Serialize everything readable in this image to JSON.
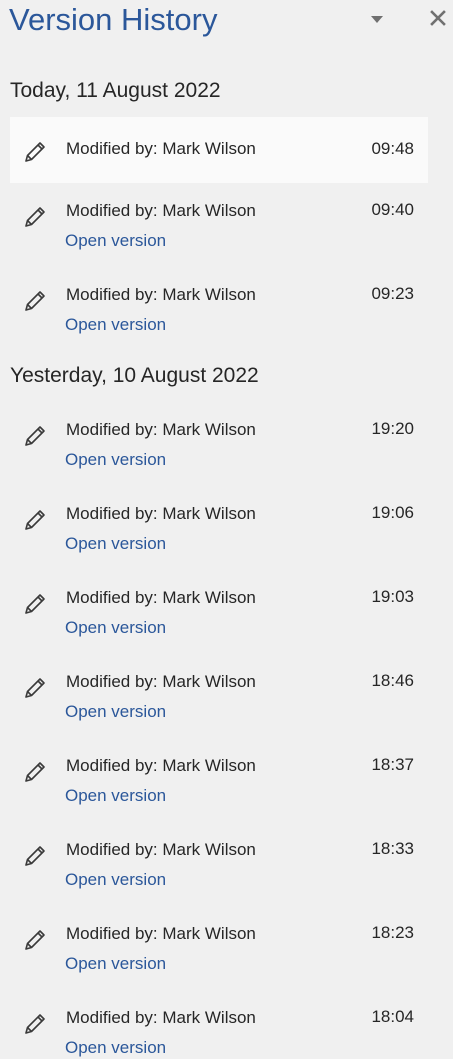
{
  "pane": {
    "title": "Version History",
    "options_icon": "triangle-down-icon",
    "close_icon": "close-icon"
  },
  "colors": {
    "accent": "#2b579a",
    "background": "#f0f0f0",
    "selected_background": "#fafafa",
    "text": "#262626"
  },
  "sections": [
    {
      "heading": "Today, 11 August 2022",
      "items": [
        {
          "modified_by": "Modified by: Mark Wilson",
          "time": "09:48",
          "selected": true
        },
        {
          "modified_by": "Modified by: Mark Wilson",
          "time": "09:40",
          "link": "Open version"
        },
        {
          "modified_by": "Modified by: Mark Wilson",
          "time": "09:23",
          "link": "Open version"
        }
      ]
    },
    {
      "heading": "Yesterday, 10 August 2022",
      "items": [
        {
          "modified_by": "Modified by: Mark Wilson",
          "time": "19:20",
          "link": "Open version"
        },
        {
          "modified_by": "Modified by: Mark Wilson",
          "time": "19:06",
          "link": "Open version"
        },
        {
          "modified_by": "Modified by: Mark Wilson",
          "time": "19:03",
          "link": "Open version"
        },
        {
          "modified_by": "Modified by: Mark Wilson",
          "time": "18:46",
          "link": "Open version"
        },
        {
          "modified_by": "Modified by: Mark Wilson",
          "time": "18:37",
          "link": "Open version"
        },
        {
          "modified_by": "Modified by: Mark Wilson",
          "time": "18:33",
          "link": "Open version"
        },
        {
          "modified_by": "Modified by: Mark Wilson",
          "time": "18:23",
          "link": "Open version"
        },
        {
          "modified_by": "Modified by: Mark Wilson",
          "time": "18:04",
          "link": "Open version"
        }
      ]
    }
  ]
}
